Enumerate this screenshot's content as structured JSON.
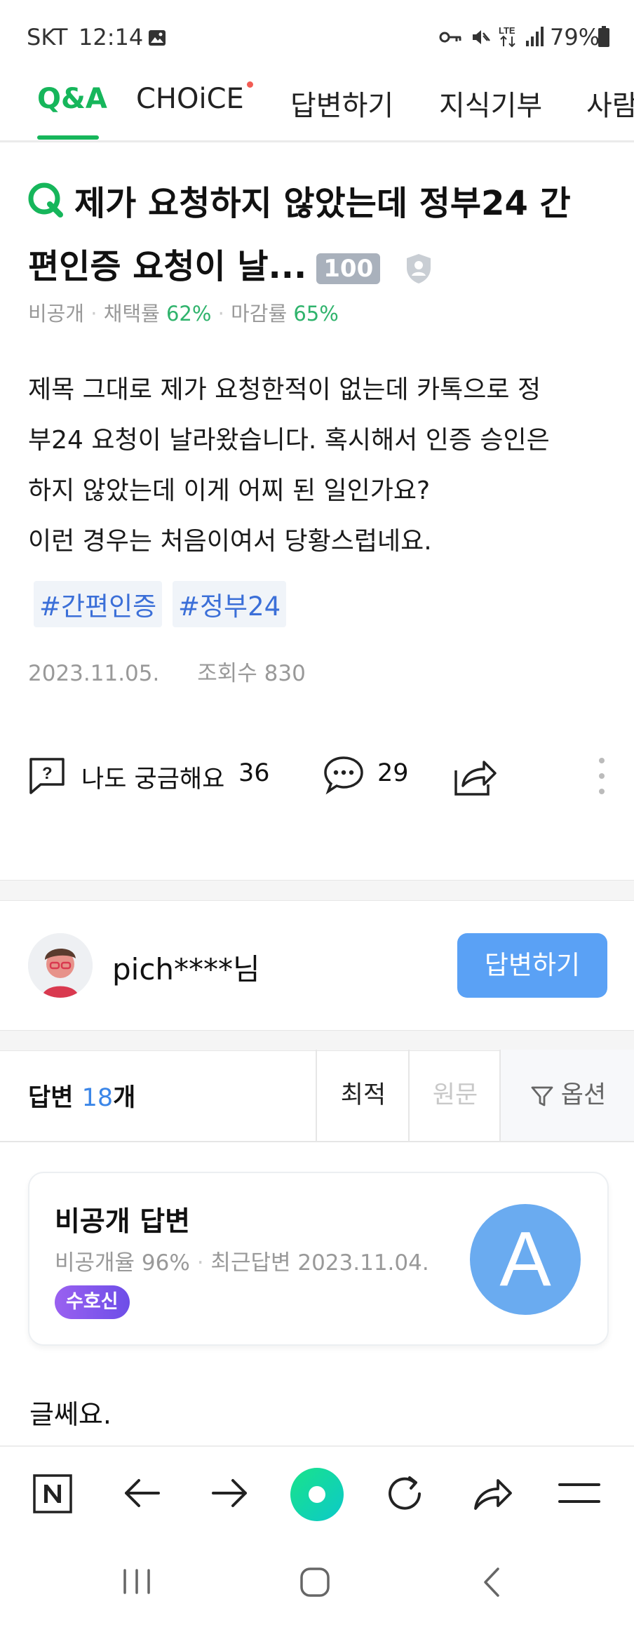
{
  "status_bar": {
    "carrier": "SKT",
    "time": "12:14",
    "battery": "79%",
    "icons": [
      "image-icon",
      "key-icon",
      "mute-icon",
      "lte-icon",
      "signal-icon",
      "battery-icon"
    ]
  },
  "tabs": [
    {
      "label": "Q&A",
      "active": true
    },
    {
      "label": "CHOiCE",
      "has_dot": true
    },
    {
      "label": "답변하기"
    },
    {
      "label": "지식기부"
    },
    {
      "label": "사람"
    }
  ],
  "question": {
    "title_line1": "제가 요청하지 않았는데 정부24 간",
    "title_line2": "편인증 요청이 날...",
    "points": "100",
    "privacy": "비공개",
    "adopt_label": "채택률",
    "adopt_rate": "62%",
    "close_label": "마감률",
    "close_rate": "65%",
    "body_lines": [
      "제목 그대로 제가 요청한적이 없는데 카톡으로 정",
      "부24 요청이 날라왔습니다. 혹시해서 인증 승인은",
      "하지 않았는데 이게 어찌 된 일인가요?",
      "이런 경우는 처음이여서 당황스럽네요."
    ],
    "tags": [
      "#간편인증",
      "#정부24"
    ],
    "date": "2023.11.05.",
    "views_label": "조회수",
    "views": "830"
  },
  "actions": {
    "curious_label": "나도 궁금해요",
    "curious_count": "36",
    "comment_count": "29"
  },
  "answer_prompt": {
    "user": "pich****님",
    "button": "답변하기"
  },
  "answers_header": {
    "label_prefix": "답변",
    "count": "18",
    "label_suffix": "개",
    "sort_best": "최적",
    "sort_original": "원문",
    "options": "옵션"
  },
  "answer_card": {
    "title": "비공개 답변",
    "private_rate": "비공개율 96%",
    "recent": "최근답변 2023.11.04.",
    "badge": "수호신",
    "avatar_letter": "A"
  },
  "answer_text": "글쎄요.",
  "colors": {
    "green": "#16b65b",
    "blue_button": "#5aa1f5",
    "tag_blue": "#3b6fd8"
  }
}
